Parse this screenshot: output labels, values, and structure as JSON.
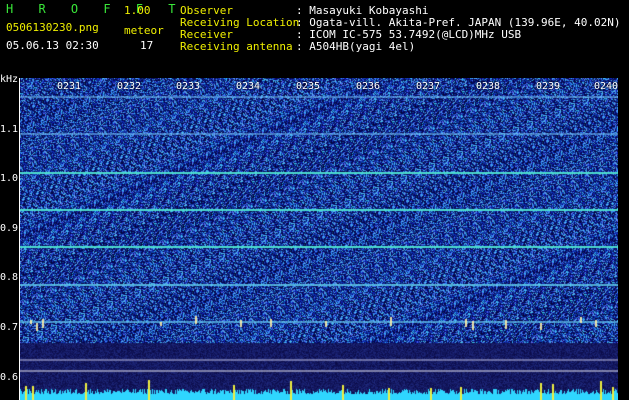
{
  "header": {
    "app_name": "H R O F F T",
    "version": "1.00",
    "filename": "0506130230.png",
    "datetime": "05.06.13 02:30",
    "meteor_label": "meteor",
    "meteor_count": "17",
    "info": [
      {
        "label": "Observer",
        "value": ": Masayuki Kobayashi"
      },
      {
        "label": "Receiving Location",
        "value": ": Ogata-vill. Akita-Pref. JAPAN (139.96E, 40.02N)"
      },
      {
        "label": "Receiver",
        "value": ": ICOM IC-575 53.7492(@LCD)MHz USB"
      },
      {
        "label": "Receiving antenna",
        "value": ": A504HB(yagi 4el)"
      }
    ]
  },
  "axis": {
    "unit": "kHz",
    "y_ticks": [
      "1.1",
      "1.0",
      "0.9",
      "0.8",
      "0.7",
      "0.6"
    ],
    "x_ticks": [
      "0231",
      "0232",
      "0233",
      "0234",
      "0235",
      "0236",
      "0237",
      "0238",
      "0239",
      "0240"
    ]
  },
  "colors": {
    "background": "#000000",
    "label_green": "#39e639",
    "label_yellow": "#f0f000",
    "noise_dark": "#0a0a6e",
    "noise_bright": "#3a6aff",
    "tone_line": "#40e0d0"
  }
}
